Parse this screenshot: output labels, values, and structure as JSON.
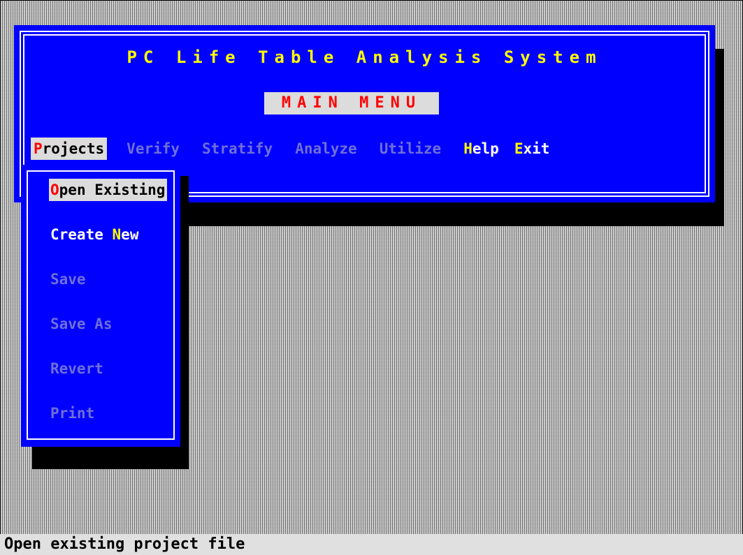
{
  "app": {
    "title": "PC Life Table Analysis System",
    "main_menu_label": "MAIN MENU"
  },
  "menubar": {
    "items": [
      {
        "key": "P",
        "rest": "rojects",
        "state": "selected"
      },
      {
        "label": "Verify",
        "state": "disabled"
      },
      {
        "label": "Stratify",
        "state": "disabled"
      },
      {
        "label": "Analyze",
        "state": "disabled"
      },
      {
        "label": "Utilize",
        "state": "disabled"
      },
      {
        "key": "H",
        "rest": "elp",
        "state": "enabled"
      },
      {
        "key": "E",
        "rest": "xit",
        "state": "enabled"
      }
    ]
  },
  "dropdown": {
    "items": [
      {
        "key": "O",
        "rest": "pen Existing",
        "state": "selected"
      },
      {
        "pre": "Create ",
        "key": "N",
        "rest": "ew",
        "state": "enabled"
      },
      {
        "label": "Save",
        "state": "disabled"
      },
      {
        "label": "Save As",
        "state": "disabled"
      },
      {
        "label": "Revert",
        "state": "disabled"
      },
      {
        "label": "Print",
        "state": "disabled"
      }
    ]
  },
  "status_bar": {
    "text": "Open existing project file"
  },
  "colors": {
    "window_bg": "#0000ff",
    "title_text": "#ffff00",
    "hotkey_selected": "#ff0000",
    "hotkey_enabled": "#ffff00",
    "disabled_text": "#6f6fd8",
    "highlight_bg": "#dcdcdc",
    "desktop_bg": "#c0c0c0"
  }
}
